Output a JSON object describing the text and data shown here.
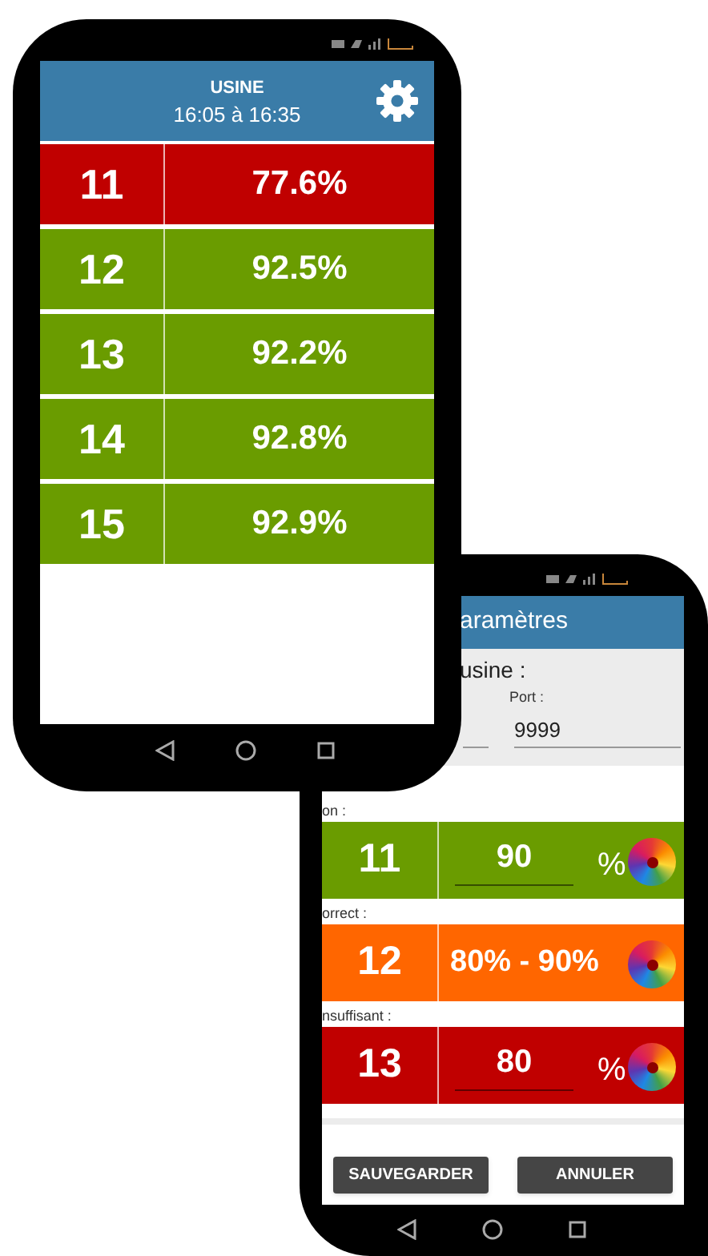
{
  "main_phone": {
    "title": "USINE",
    "subtitle": "16:05 à 16:35",
    "rows": [
      {
        "number": "11",
        "value": "77.6%",
        "color": "#c00000"
      },
      {
        "number": "12",
        "value": "92.5%",
        "color": "#6a9c00"
      },
      {
        "number": "13",
        "value": "92.2%",
        "color": "#6a9c00"
      },
      {
        "number": "14",
        "value": "92.8%",
        "color": "#6a9c00"
      },
      {
        "number": "15",
        "value": "92.9%",
        "color": "#6a9c00"
      }
    ]
  },
  "settings_phone": {
    "title": "aramètres",
    "section": "usine :",
    "port_label": "Port :",
    "port_value": "9999",
    "levels": [
      {
        "label": "on :",
        "number": "11",
        "kind": "input",
        "value": "90",
        "unit": "%",
        "color": "#6a9c00"
      },
      {
        "label": "orrect :",
        "number": "12",
        "kind": "range",
        "value": "80% - 90%",
        "color": "#ff6600"
      },
      {
        "label": "nsuffisant :",
        "number": "13",
        "kind": "input",
        "value": "80",
        "unit": "%",
        "color": "#c00000"
      }
    ],
    "buttons": [
      "SAUVEGARDER",
      "ANNULER"
    ]
  }
}
